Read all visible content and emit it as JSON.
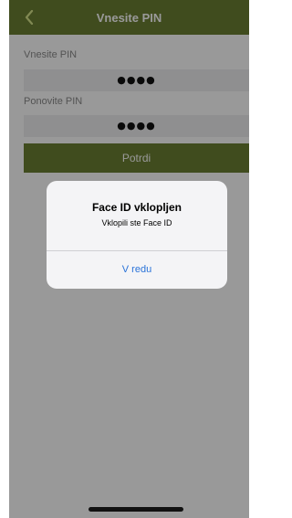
{
  "nav": {
    "title": "Vnesite PIN",
    "back_icon": "chevron-left-icon"
  },
  "form": {
    "pin_label": "Vnesite PIN",
    "pin_value": "●●●●",
    "repeat_label": "Ponovite PIN",
    "repeat_value": "●●●●",
    "confirm_label": "Potrdi"
  },
  "alert": {
    "title": "Face ID vklopljen",
    "message": "Vklopili ste Face ID",
    "button_label": "V redu"
  },
  "colors": {
    "brand": "#6b7f32",
    "alert_button": "#2a73d9",
    "overlay": "rgba(0,0,0,0.40)"
  }
}
